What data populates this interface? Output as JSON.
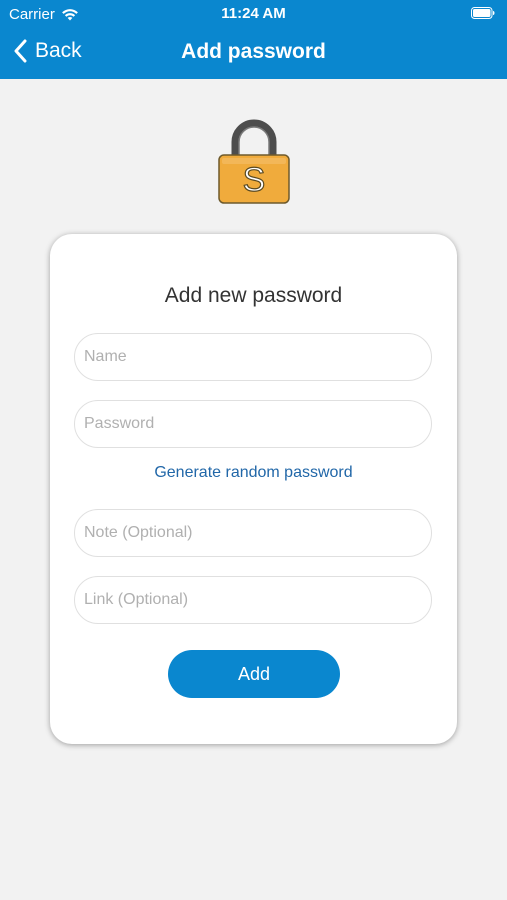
{
  "status_bar": {
    "carrier": "Carrier",
    "time": "11:24 AM",
    "wifi_icon": "wifi-icon",
    "battery_icon": "battery-icon"
  },
  "nav": {
    "back_label": "Back",
    "back_icon": "chevron-left-icon",
    "title": "Add password"
  },
  "header_icon": {
    "name": "padlock-icon",
    "letter": "S"
  },
  "form": {
    "title": "Add new password",
    "name_placeholder": "Name",
    "password_placeholder": "Password",
    "generate_link": "Generate random password",
    "note_placeholder": "Note (Optional)",
    "link_placeholder": "Link (Optional)",
    "add_label": "Add"
  },
  "colors": {
    "accent": "#0a87cf",
    "link": "#2167a8",
    "background": "#f2f2f2",
    "lock_body": "#f0ab3c"
  }
}
